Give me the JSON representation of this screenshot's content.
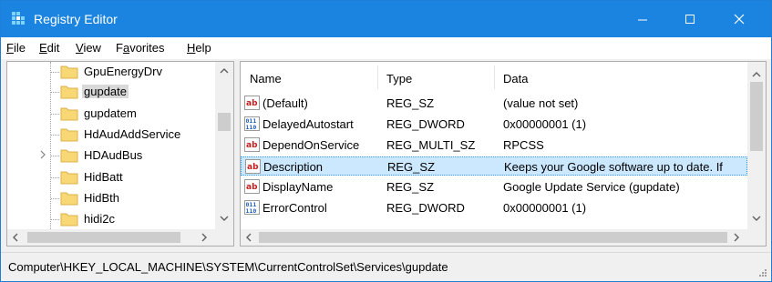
{
  "window": {
    "title": "Registry Editor",
    "accent_color": "#1a84e0",
    "icons": {
      "app": "registry-editor-icon",
      "minimize": "minimize-icon",
      "maximize": "maximize-icon",
      "close": "close-icon"
    }
  },
  "menu": {
    "items": [
      {
        "label": "File",
        "mnemonic": "F",
        "rest": "ile"
      },
      {
        "label": "Edit",
        "mnemonic": "E",
        "rest": "dit"
      },
      {
        "label": "View",
        "mnemonic": "V",
        "rest": "iew"
      },
      {
        "label": "Favorites",
        "mnemonic": "a",
        "pre": "F",
        "rest": "vorites"
      },
      {
        "label": "Help",
        "mnemonic": "H",
        "rest": "elp"
      }
    ]
  },
  "tree": {
    "items": [
      {
        "label": "GpuEnergyDrv",
        "selected": false,
        "expandable": false
      },
      {
        "label": "gupdate",
        "selected": true,
        "expandable": false
      },
      {
        "label": "gupdatem",
        "selected": false,
        "expandable": false
      },
      {
        "label": "HdAudAddService",
        "selected": false,
        "expandable": false
      },
      {
        "label": "HDAudBus",
        "selected": false,
        "expandable": true
      },
      {
        "label": "HidBatt",
        "selected": false,
        "expandable": false
      },
      {
        "label": "HidBth",
        "selected": false,
        "expandable": false
      },
      {
        "label": "hidi2c",
        "selected": false,
        "expandable": false
      }
    ]
  },
  "list": {
    "columns": {
      "name": "Name",
      "type": "Type",
      "data": "Data"
    },
    "rows": [
      {
        "icon": "string-value-icon",
        "name": "(Default)",
        "type": "REG_SZ",
        "data": "(value not set)",
        "selected": false
      },
      {
        "icon": "binary-value-icon",
        "name": "DelayedAutostart",
        "type": "REG_DWORD",
        "data": "0x00000001 (1)",
        "selected": false
      },
      {
        "icon": "string-value-icon",
        "name": "DependOnService",
        "type": "REG_MULTI_SZ",
        "data": "RPCSS",
        "selected": false
      },
      {
        "icon": "string-value-icon",
        "name": "Description",
        "type": "REG_SZ",
        "data": "Keeps your Google software up to date. If",
        "selected": true
      },
      {
        "icon": "string-value-icon",
        "name": "DisplayName",
        "type": "REG_SZ",
        "data": "Google Update Service (gupdate)",
        "selected": false
      },
      {
        "icon": "binary-value-icon",
        "name": "ErrorControl",
        "type": "REG_DWORD",
        "data": "0x00000001 (1)",
        "selected": false
      }
    ],
    "selection_color": "#cce8ff"
  },
  "status": {
    "path": "Computer\\HKEY_LOCAL_MACHINE\\SYSTEM\\CurrentControlSet\\Services\\gupdate"
  }
}
